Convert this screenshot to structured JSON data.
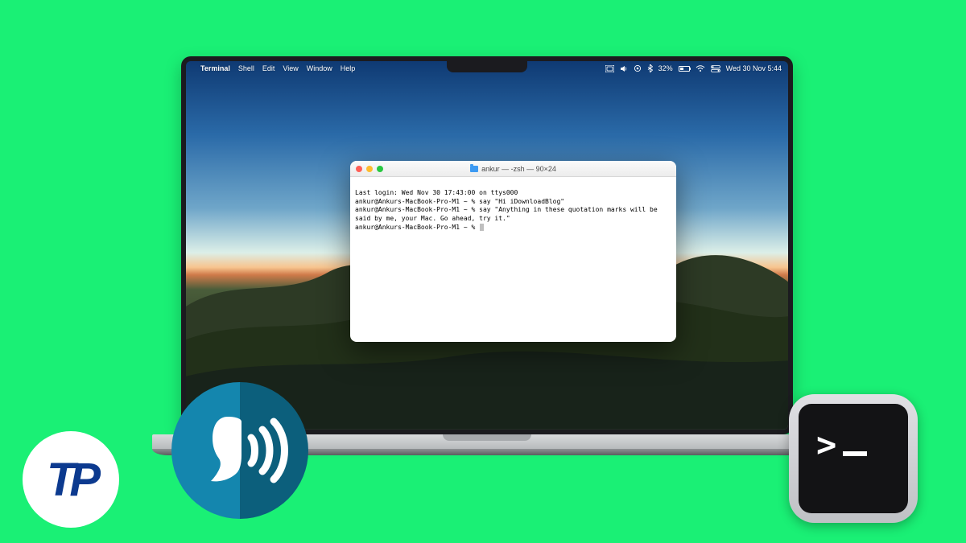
{
  "menubar": {
    "app_name": "Terminal",
    "items": [
      "Shell",
      "Edit",
      "View",
      "Window",
      "Help"
    ],
    "battery_pct": "32%",
    "datetime": "Wed 30 Nov 5:44"
  },
  "terminal": {
    "title": "ankur — -zsh — 90×24",
    "lines": [
      "Last login: Wed Nov 30 17:43:00 on ttys000",
      "ankur@Ankurs-MacBook-Pro-M1 ~ % say \"Hi iDownloadBlog\"",
      "ankur@Ankurs-MacBook-Pro-M1 ~ % say \"Anything in these quotation marks will be said by me, your Mac. Go ahead, try it.\"",
      "ankur@Ankurs-MacBook-Pro-M1 ~ % "
    ]
  },
  "badges": {
    "tp_text": "TP",
    "term_prompt": ">"
  }
}
